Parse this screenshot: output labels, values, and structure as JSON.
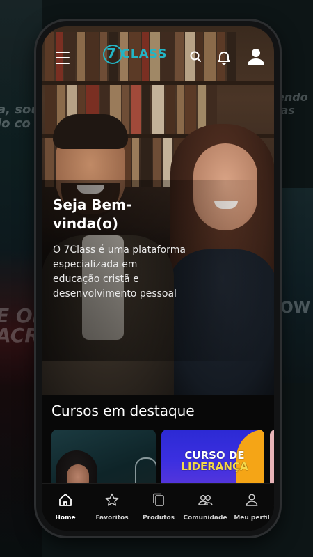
{
  "app": {
    "brand": "CLASS",
    "brand_number": "7"
  },
  "header": {
    "menu_icon": "hamburger-menu-icon",
    "search_icon": "search-icon",
    "notifications_icon": "bell-icon",
    "profile_icon": "user-icon"
  },
  "hero": {
    "title_line1": "Seja Bem-",
    "title_line2": "vinda(o)",
    "description_lines": [
      "O 7Class é uma plataforma",
      "especializada em",
      "educação cristã e",
      "desenvolvimento pessoal"
    ]
  },
  "featured": {
    "title": "Cursos em destaque",
    "courses": [
      {
        "label": ""
      },
      {
        "label_line1": "CURSO DE",
        "label_line2": "LIDERANÇA"
      },
      {
        "label": ""
      }
    ]
  },
  "nav": {
    "items": [
      {
        "label": "Home",
        "icon": "home-icon",
        "active": true
      },
      {
        "label": "Favoritos",
        "icon": "star-icon",
        "active": false
      },
      {
        "label": "Produtos",
        "icon": "copy-icon",
        "active": false
      },
      {
        "label": "Comunidade",
        "icon": "users-icon",
        "active": false
      },
      {
        "label": "Meu perfil",
        "icon": "user-icon",
        "active": false
      }
    ]
  },
  "colors": {
    "brand_accent": "#23b5c5",
    "background": "#080808",
    "course_purple": "#2c2ad4",
    "course_orange": "#f5a516"
  }
}
